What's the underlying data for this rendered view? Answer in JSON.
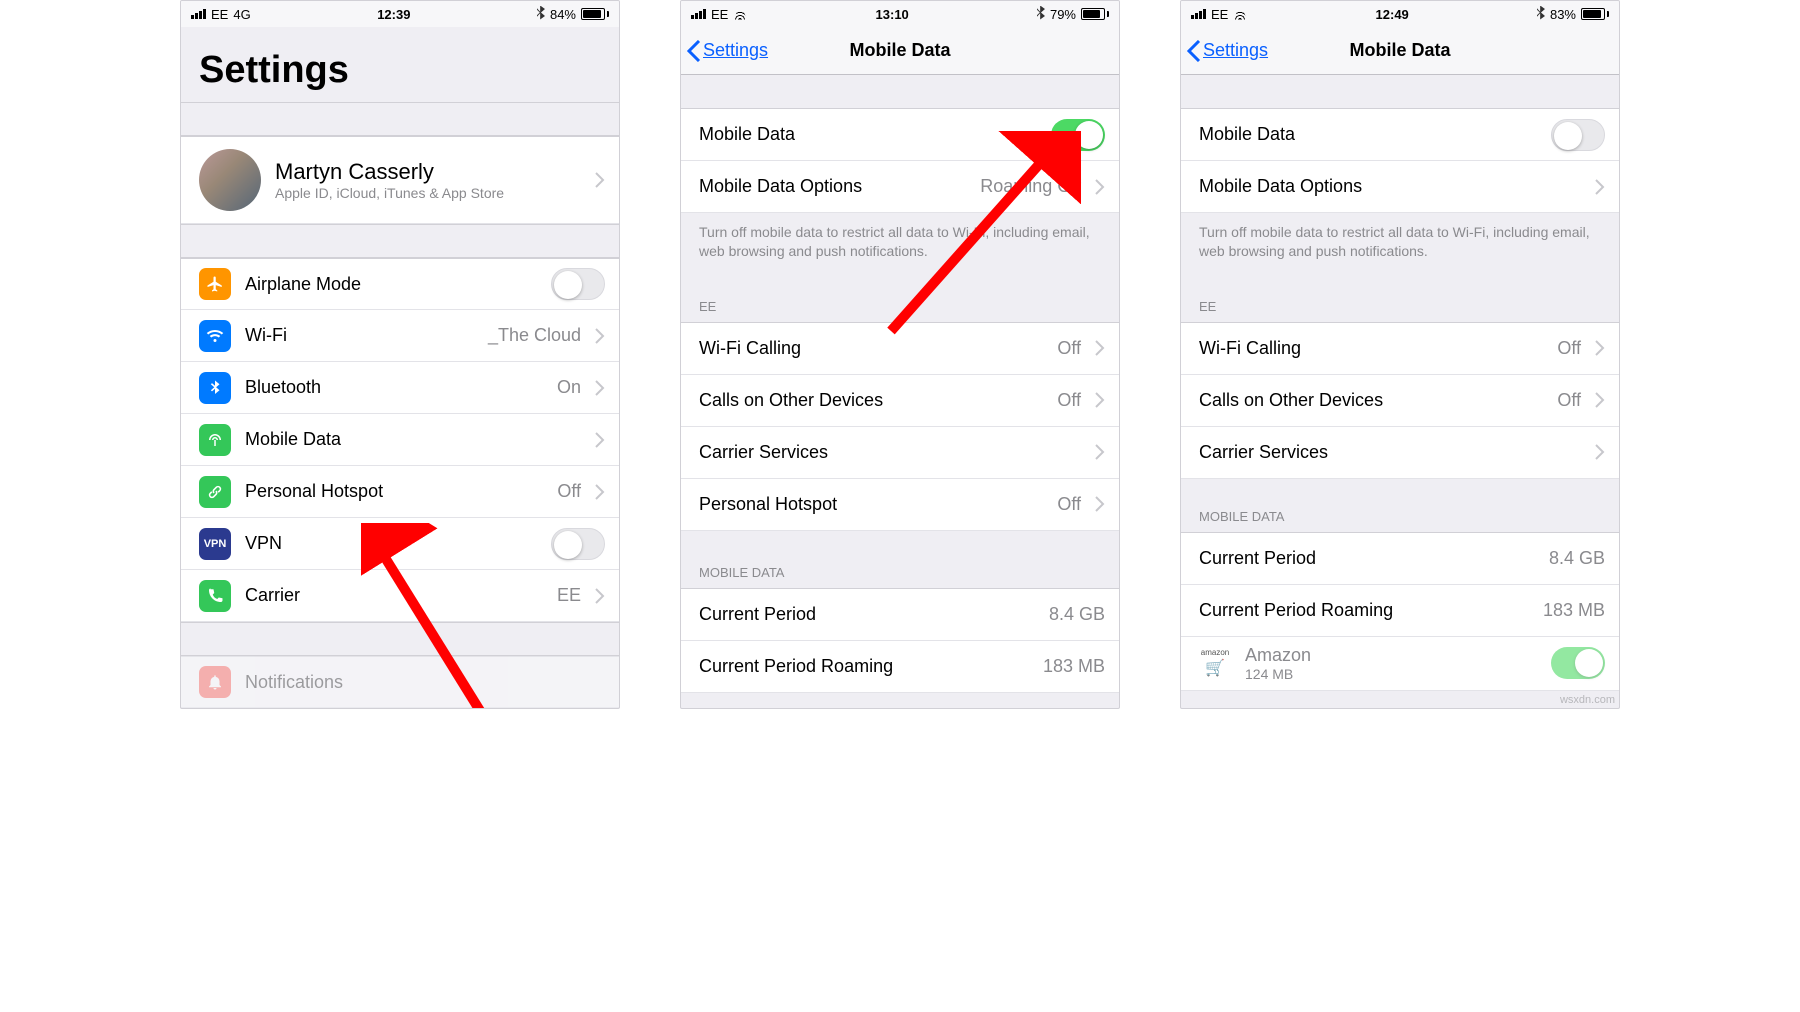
{
  "colors": {
    "orange": "#ff9500",
    "blue": "#007aff",
    "green": "#34c759",
    "darkgreen": "#30b94e",
    "navy": "#2b3a8f",
    "red": "#ff3b30"
  },
  "watermark": "wsxdn.com",
  "screens": [
    {
      "status": {
        "carrier": "EE",
        "net": "4G",
        "time": "12:39",
        "battery": "84%",
        "battFill": 84,
        "wifi": false
      },
      "big_title": "Settings",
      "profile": {
        "name": "Martyn Casserly",
        "sub": "Apple ID, iCloud, iTunes & App Store"
      },
      "rows": [
        {
          "icon": "airplane",
          "icon_bg": "#ff9500",
          "label": "Airplane Mode",
          "toggle": "off"
        },
        {
          "icon": "wifi",
          "icon_bg": "#007aff",
          "label": "Wi-Fi",
          "value": "_The Cloud",
          "chev": true
        },
        {
          "icon": "bluetooth",
          "icon_bg": "#007aff",
          "label": "Bluetooth",
          "value": "On",
          "chev": true
        },
        {
          "icon": "antenna",
          "icon_bg": "#34c759",
          "label": "Mobile Data",
          "chev": true
        },
        {
          "icon": "link",
          "icon_bg": "#34c759",
          "label": "Personal Hotspot",
          "value": "Off",
          "chev": true,
          "truncate": true
        },
        {
          "icon": "vpn",
          "icon_bg": "#2b3a8f",
          "label": "VPN",
          "toggle": "off"
        },
        {
          "icon": "phone",
          "icon_bg": "#34c759",
          "label": "Carrier",
          "value": "EE",
          "chev": true
        }
      ],
      "trailing": {
        "icon": "bell",
        "icon_bg": "#ff3b30",
        "label": "Notifications"
      }
    },
    {
      "status": {
        "carrier": "EE",
        "time": "13:10",
        "battery": "79%",
        "battFill": 79,
        "wifi": true
      },
      "nav": {
        "back": "Settings",
        "title": "Mobile Data"
      },
      "body": [
        {
          "type": "row",
          "label": "Mobile Data",
          "toggle": "on"
        },
        {
          "type": "row",
          "label": "Mobile Data Options",
          "value": "Roaming Off",
          "chev": true,
          "value_obscured": true
        },
        {
          "type": "footer",
          "text": "Turn off mobile data to restrict all data to Wi-Fi, including email, web browsing and push notifications."
        },
        {
          "type": "header",
          "text": "EE"
        },
        {
          "type": "row",
          "label": "Wi-Fi Calling",
          "value": "Off",
          "chev": true
        },
        {
          "type": "row",
          "label": "Calls on Other Devices",
          "value": "Off",
          "chev": true
        },
        {
          "type": "row",
          "label": "Carrier Services",
          "chev": true
        },
        {
          "type": "row",
          "label": "Personal Hotspot",
          "value": "Off",
          "chev": true
        },
        {
          "type": "header",
          "text": "MOBILE DATA"
        },
        {
          "type": "row",
          "label": "Current Period",
          "value": "8.4 GB"
        },
        {
          "type": "row",
          "label": "Current Period Roaming",
          "value": "183 MB"
        }
      ]
    },
    {
      "status": {
        "carrier": "EE",
        "time": "12:49",
        "battery": "83%",
        "battFill": 83,
        "wifi": true
      },
      "nav": {
        "back": "Settings",
        "title": "Mobile Data"
      },
      "body": [
        {
          "type": "row",
          "label": "Mobile Data",
          "toggle": "off"
        },
        {
          "type": "row",
          "label": "Mobile Data Options",
          "chev": true
        },
        {
          "type": "footer",
          "text": "Turn off mobile data to restrict all data to Wi-Fi, including email, web browsing and push notifications."
        },
        {
          "type": "header",
          "text": "EE"
        },
        {
          "type": "row",
          "label": "Wi-Fi Calling",
          "value": "Off",
          "chev": true
        },
        {
          "type": "row",
          "label": "Calls on Other Devices",
          "value": "Off",
          "chev": true
        },
        {
          "type": "row",
          "label": "Carrier Services",
          "chev": true
        },
        {
          "type": "header",
          "text": "MOBILE DATA"
        },
        {
          "type": "row",
          "label": "Current Period",
          "value": "8.4 GB"
        },
        {
          "type": "row",
          "label": "Current Period Roaming",
          "value": "183 MB"
        },
        {
          "type": "app",
          "app": "Amazon",
          "appsub": "124 MB",
          "toggle": "on",
          "app_label": "amazon"
        }
      ]
    }
  ]
}
